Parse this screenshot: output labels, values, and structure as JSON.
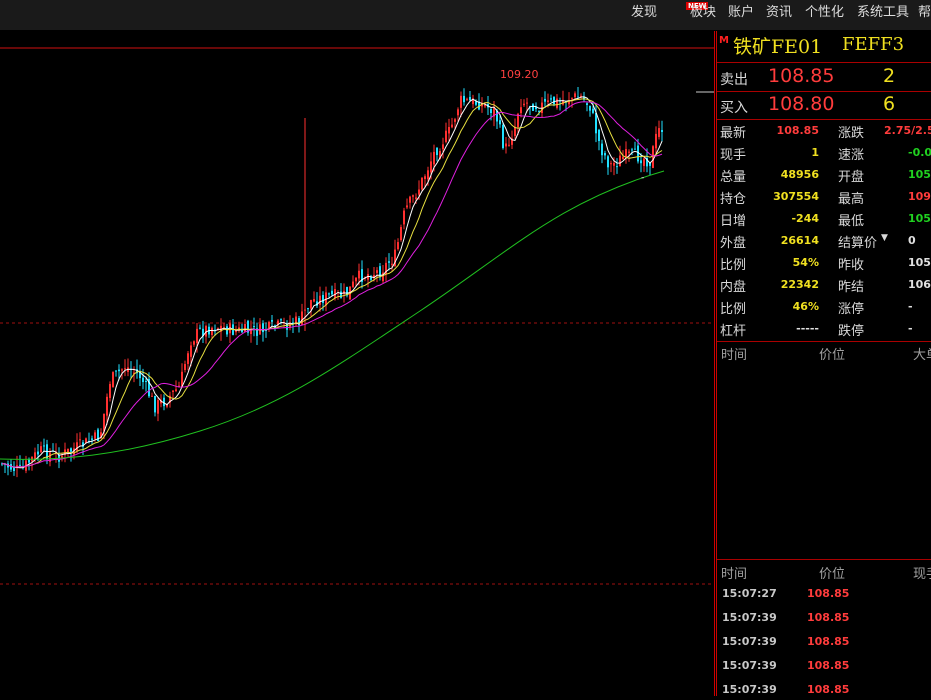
{
  "menu": [
    {
      "key": "discover",
      "label": "发现"
    },
    {
      "key": "sector",
      "label": "板块"
    },
    {
      "key": "account",
      "label": "账户"
    },
    {
      "key": "news",
      "label": "资讯"
    },
    {
      "key": "personalize",
      "label": "个性化"
    },
    {
      "key": "tools",
      "label": "系统工具"
    },
    {
      "key": "help",
      "label": "帮"
    }
  ],
  "new_badge": "NEW",
  "chart": {
    "peak_label": "109.20",
    "colors": {
      "up": "#ff3030",
      "down": "#20e0ff",
      "ma_yellow": "#e8e040",
      "ma_white": "#ffffff",
      "ma_magenta": "#e020e0",
      "ma_green": "#20c020"
    }
  },
  "quote": {
    "marker": "M",
    "name": "铁矿FE01",
    "code": "FEFF3",
    "ask": {
      "label": "卖出",
      "price": "108.85",
      "volume": "2"
    },
    "bid": {
      "label": "买入",
      "price": "108.80",
      "volume": "6"
    },
    "left": [
      {
        "label": "最新",
        "value": "108.85",
        "color": "red"
      },
      {
        "label": "现手",
        "value": "1",
        "color": "yel"
      },
      {
        "label": "总量",
        "value": "48956",
        "color": "yel"
      },
      {
        "label": "持仓",
        "value": "307554",
        "color": "yel"
      },
      {
        "label": "日增",
        "value": "-244",
        "color": "yel"
      },
      {
        "label": "外盘",
        "value": "26614",
        "color": "yel"
      },
      {
        "label": "比例",
        "value": "54%",
        "color": "yel"
      },
      {
        "label": "内盘",
        "value": "22342",
        "color": "yel"
      },
      {
        "label": "比例",
        "value": "46%",
        "color": "yel"
      },
      {
        "label": "杠杆",
        "value": "-----",
        "color": "wht"
      }
    ],
    "right": [
      {
        "label": "涨跌",
        "value": "2.75/2.5",
        "color": "red"
      },
      {
        "label": "速涨",
        "value": "-0.0",
        "color": "grn"
      },
      {
        "label": "开盘",
        "value": "105",
        "color": "grn"
      },
      {
        "label": "最高",
        "value": "109",
        "color": "red"
      },
      {
        "label": "最低",
        "value": "105",
        "color": "grn"
      },
      {
        "label": "结算价",
        "value": "0",
        "color": "wht"
      },
      {
        "label": "昨收",
        "value": "105",
        "color": "wht"
      },
      {
        "label": "昨结",
        "value": "106",
        "color": "wht"
      },
      {
        "label": "涨停",
        "value": "-",
        "color": "wht"
      },
      {
        "label": "跌停",
        "value": "-",
        "color": "wht"
      }
    ],
    "upper_table_headers": {
      "time": "时间",
      "price": "价位",
      "vol": "大单"
    },
    "lower_table_headers": {
      "time": "时间",
      "price": "价位",
      "vol": "现手"
    },
    "trades": [
      {
        "time": "15:07:27",
        "price": "108.85"
      },
      {
        "time": "15:07:39",
        "price": "108.85"
      },
      {
        "time": "15:07:39",
        "price": "108.85"
      },
      {
        "time": "15:07:39",
        "price": "108.85"
      },
      {
        "time": "15:07:39",
        "price": "108.85"
      }
    ]
  }
}
